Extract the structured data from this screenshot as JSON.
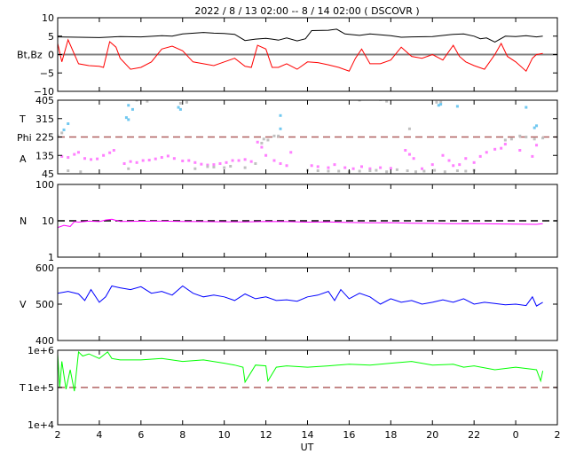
{
  "chart_data": {
    "type": "line",
    "title": "2022 /  8 / 13   02:00 --  8 / 14   02:00 ( DSCOVR )",
    "xlabel": "UT",
    "x_ticks": [
      "2",
      "4",
      "6",
      "8",
      "10",
      "12",
      "14",
      "16",
      "18",
      "20",
      "22",
      "0",
      "2"
    ],
    "xlim": [
      2,
      26
    ],
    "panels": [
      {
        "ylabels": [
          "Bt,Bz"
        ],
        "ylim": [
          -10,
          10
        ],
        "scale": "linear",
        "yticks": [
          "10",
          "5",
          "0",
          "−5",
          "−10"
        ],
        "ytick_values": [
          10,
          5,
          0,
          -5,
          -10
        ],
        "refline": {
          "value": 0,
          "color": "#808080",
          "dash": false
        },
        "series": [
          {
            "name": "Bt",
            "color": "#000000",
            "type": "line",
            "x": [
              2,
              3,
              4,
              5,
              6,
              7,
              7.5,
              8,
              9,
              9.5,
              10,
              10.5,
              11,
              11.5,
              12,
              12.3,
              12.6,
              13,
              13.5,
              13.9,
              14.2,
              15,
              15.4,
              15.8,
              16.5,
              17,
              18,
              18.5,
              19,
              20,
              21,
              21.5,
              22,
              22.3,
              22.6,
              23,
              23.5,
              24,
              24.5,
              25,
              25.3
            ],
            "y": [
              4.8,
              4.7,
              4.6,
              4.9,
              4.8,
              5.1,
              5,
              5.6,
              6,
              5.8,
              5.7,
              5.5,
              3.8,
              4.2,
              4.4,
              4.2,
              3.9,
              4.5,
              3.7,
              4.3,
              6.5,
              6.6,
              6.9,
              5.6,
              5.2,
              5.6,
              5.1,
              4.7,
              4.8,
              4.9,
              5.5,
              5.6,
              5,
              4.3,
              4.5,
              3.4,
              5,
              4.9,
              5.1,
              4.8,
              5
            ]
          },
          {
            "name": "Bz",
            "color": "#ff0000",
            "type": "line",
            "x": [
              2,
              2.2,
              2.5,
              3,
              3.5,
              4,
              4.2,
              4.5,
              4.8,
              5,
              5.5,
              6,
              6.5,
              7,
              7.5,
              8,
              8.5,
              9,
              9.5,
              10,
              10.5,
              11,
              11.3,
              11.6,
              12,
              12.3,
              12.6,
              13,
              13.5,
              14,
              14.5,
              15,
              15.5,
              16,
              16.3,
              16.6,
              17,
              17.5,
              18,
              18.5,
              19,
              19.5,
              20,
              20.5,
              21,
              21.3,
              21.6,
              22,
              22.5,
              23,
              23.3,
              23.6,
              24,
              24.5,
              24.8,
              25,
              25.3
            ],
            "y": [
              3,
              -2,
              4,
              -2.5,
              -3,
              -3.2,
              -3.5,
              3.5,
              2,
              -1,
              -4,
              -3.5,
              -2,
              1.5,
              2.3,
              1,
              -2,
              -2.5,
              -3,
              -2,
              -1,
              -3.2,
              -3.5,
              2.5,
              1.5,
              -3.5,
              -3.5,
              -2.5,
              -4,
              -2,
              -2.2,
              -2.8,
              -3.5,
              -4.5,
              -1,
              1.5,
              -2.5,
              -2.5,
              -1.5,
              2,
              -0.5,
              -1,
              0,
              -1.5,
              2.5,
              -0.5,
              -2,
              -3,
              -4,
              0,
              3,
              -0.5,
              -2,
              -4.5,
              -1,
              0,
              0.3
            ]
          }
        ]
      },
      {
        "ylabels": [
          "T",
          "Phi",
          "A"
        ],
        "ylim": [
          45,
          405
        ],
        "scale": "linear",
        "yticks": [
          "405",
          "315",
          "225",
          "135",
          "45"
        ],
        "ytick_values": [
          405,
          315,
          225,
          135,
          45
        ],
        "refline": {
          "value": 225,
          "color": "#b06060",
          "dash": true
        },
        "series": [
          {
            "name": "Phi magenta",
            "color": "#ff80ff",
            "type": "scatter",
            "x": [
              2.2,
              2.5,
              2.8,
              3,
              3.3,
              3.6,
              3.9,
              4.2,
              4.5,
              4.7,
              5.2,
              5.5,
              5.8,
              6.1,
              6.4,
              6.7,
              7,
              7.3,
              7.6,
              8,
              8.3,
              8.6,
              8.9,
              9.2,
              9.5,
              9.8,
              10.1,
              10.4,
              10.7,
              11,
              11.3,
              11.6,
              11.8,
              12,
              12.4,
              12.7,
              13,
              13.2,
              14.2,
              14.5,
              15,
              15.3,
              15.8,
              16.2,
              16.6,
              17,
              17.5,
              18,
              18.7,
              18.9,
              19.1,
              19.5,
              20,
              20.5,
              20.8,
              21,
              21.3,
              21.6,
              22,
              22.3,
              22.6,
              23,
              23.3,
              23.5,
              24.2,
              24.8,
              25
            ],
            "y": [
              130,
              125,
              140,
              150,
              120,
              115,
              118,
              135,
              148,
              160,
              95,
              105,
              100,
              110,
              112,
              118,
              125,
              132,
              120,
              108,
              110,
              100,
              92,
              88,
              90,
              95,
              100,
              110,
              110,
              115,
              105,
              200,
              175,
              135,
              110,
              95,
              85,
              150,
              85,
              80,
              75,
              90,
              75,
              70,
              80,
              70,
              75,
              72,
              160,
              140,
              120,
              70,
              90,
              135,
              110,
              85,
              90,
              120,
              100,
              130,
              150,
              165,
              170,
              190,
              160,
              130,
              185
            ]
          },
          {
            "name": "Phi gray",
            "color": "#c0c0c0",
            "type": "scatter",
            "x": [
              2,
              2.2,
              2.5,
              3.1,
              5.4,
              5.8,
              6.3,
              7.9,
              8.2,
              8.6,
              9.2,
              9.5,
              10,
              10.3,
              11,
              11.5,
              11.8,
              12.1,
              12.4,
              14,
              14.5,
              15,
              15.5,
              16,
              16.5,
              17,
              17.3,
              17.8,
              18.3,
              18.8,
              19.2,
              19.6,
              20.1,
              20.6,
              21.2,
              21.6,
              22,
              23.5,
              23.8,
              24.2,
              24.5,
              24.9,
              25.3,
              16.5,
              17.5,
              17.8,
              20.2,
              20.4,
              11.9,
              12.6,
              18.9
            ],
            "y": [
              230,
              245,
              60,
              55,
              70,
              405,
              400,
              390,
              395,
              70,
              80,
              78,
              75,
              82,
              75,
              95,
              195,
              210,
              230,
              62,
              60,
              58,
              58,
              55,
              58,
              60,
              62,
              55,
              65,
              60,
              55,
              58,
              62,
              55,
              60,
              58,
              62,
              210,
              215,
              230,
              225,
              215,
              220,
              405,
              408,
              400,
              395,
              395,
              215,
              230,
              265
            ]
          },
          {
            "name": "Phi blue",
            "color": "#70c8f0",
            "type": "scatter",
            "x": [
              2.3,
              2.5,
              5.3,
              5.4,
              5.4,
              5.6,
              7.9,
              7.8,
              12.7,
              12.7,
              20.3,
              20.4,
              21.2,
              24.5,
              24.9,
              25
            ],
            "y": [
              260,
              290,
              320,
              310,
              380,
              360,
              360,
              370,
              330,
              265,
              380,
              385,
              375,
              370,
              270,
              280
            ]
          }
        ]
      },
      {
        "ylabels": [
          "N"
        ],
        "ylim": [
          1,
          100
        ],
        "scale": "log",
        "yticks": [
          "100",
          "10",
          "1"
        ],
        "ytick_values": [
          100,
          10,
          1
        ],
        "refline": {
          "value": 10,
          "color": "#000000",
          "dash": true
        },
        "series": [
          {
            "name": "N",
            "color": "#ff00ff",
            "type": "line",
            "x": [
              2,
              2.3,
              2.6,
              2.8,
              3,
              3.5,
              4,
              4.3,
              4.6,
              5,
              6,
              7,
              8,
              9,
              10,
              11,
              12,
              13,
              14,
              15,
              16,
              17,
              18,
              19,
              20,
              21,
              22,
              23,
              24,
              25,
              25.3
            ],
            "y": [
              6.5,
              7.5,
              7,
              9.5,
              9.2,
              9.8,
              9.5,
              10.5,
              11,
              9.6,
              9.7,
              9.8,
              9.6,
              9.5,
              9.4,
              9.3,
              9.6,
              9.5,
              9.2,
              9.3,
              9,
              8.8,
              8.9,
              8.6,
              8.5,
              8.3,
              8.4,
              8.2,
              8.1,
              8,
              8.3
            ]
          }
        ]
      },
      {
        "ylabels": [
          "V"
        ],
        "ylim": [
          400,
          600
        ],
        "scale": "linear",
        "yticks": [
          "600",
          "500",
          "400"
        ],
        "ytick_values": [
          600,
          500,
          400
        ],
        "series": [
          {
            "name": "V",
            "color": "#0000ff",
            "type": "line",
            "x": [
              2,
              2.5,
              3,
              3.3,
              3.6,
              4,
              4.3,
              4.6,
              5,
              5.5,
              6,
              6.5,
              7,
              7.5,
              8,
              8.5,
              9,
              9.5,
              10,
              10.5,
              11,
              11.5,
              12,
              12.5,
              13,
              13.5,
              14,
              14.5,
              15,
              15.3,
              15.6,
              16,
              16.5,
              17,
              17.5,
              18,
              18.5,
              19,
              19.5,
              20,
              20.5,
              21,
              21.5,
              22,
              22.5,
              23,
              23.5,
              24,
              24.5,
              24.8,
              25,
              25.3
            ],
            "y": [
              530,
              535,
              528,
              510,
              540,
              505,
              520,
              550,
              545,
              540,
              548,
              530,
              535,
              525,
              550,
              530,
              520,
              525,
              520,
              510,
              528,
              515,
              520,
              510,
              512,
              508,
              520,
              525,
              535,
              510,
              540,
              515,
              530,
              520,
              500,
              515,
              505,
              510,
              500,
              505,
              512,
              505,
              515,
              500,
              505,
              502,
              498,
              500,
              496,
              520,
              495,
              505
            ]
          }
        ]
      },
      {
        "ylabels": [
          "T"
        ],
        "ylim": [
          10000,
          1000000
        ],
        "scale": "log",
        "yticks": [
          "1e+6",
          "1e+5",
          "1e+4"
        ],
        "ytick_values": [
          1000000,
          100000,
          10000
        ],
        "refline": {
          "value": 100000,
          "color": "#b06060",
          "dash": true
        },
        "series": [
          {
            "name": "T",
            "color": "#00ff00",
            "type": "line",
            "x": [
              2,
              2.1,
              2.2,
              2.4,
              2.6,
              2.8,
              3,
              3.2,
              3.5,
              4,
              4.4,
              4.6,
              5,
              6,
              7,
              8,
              9,
              10,
              10.5,
              10.9,
              11,
              11.5,
              12,
              12.1,
              12.5,
              13,
              14,
              15,
              16,
              17,
              18,
              19,
              20,
              21,
              21.5,
              22,
              23,
              24,
              25,
              25.2,
              25.3
            ],
            "y": [
              800000,
              100000,
              500000,
              90000,
              300000,
              80000,
              900000,
              700000,
              800000,
              600000,
              900000,
              600000,
              550000,
              550000,
              600000,
              500000,
              550000,
              450000,
              400000,
              350000,
              140000,
              400000,
              380000,
              150000,
              350000,
              380000,
              350000,
              380000,
              420000,
              400000,
              450000,
              500000,
              400000,
              420000,
              350000,
              380000,
              300000,
              350000,
              300000,
              150000,
              280000
            ]
          }
        ]
      }
    ]
  }
}
